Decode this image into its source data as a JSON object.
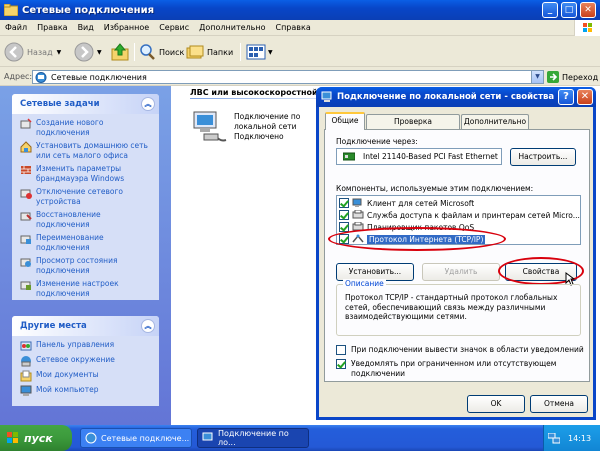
{
  "window": {
    "title": "Сетевые подключения"
  },
  "menu": [
    "Файл",
    "Правка",
    "Вид",
    "Избранное",
    "Сервис",
    "Дополнительно",
    "Справка"
  ],
  "toolbar": {
    "back": "Назад",
    "search": "Поиск",
    "folders": "Папки"
  },
  "address": {
    "label": "Адрес:",
    "value": "Сетевые подключения",
    "go": "Переход"
  },
  "left_panel": {
    "network_tasks": {
      "title": "Сетевые задачи",
      "items": [
        "Создание нового подключения",
        "Установить домашнюю сеть или сеть малого офиса",
        "Изменить параметры брандмауэра Windows",
        "Отключение сетевого устройства",
        "Восстановление подключения",
        "Переименование подключения",
        "Просмотр состояния подключения",
        "Изменение настроек подключения"
      ]
    },
    "other_places": {
      "title": "Другие места",
      "items": [
        "Панель управления",
        "Сетевое окружение",
        "Мои документы",
        "Мой компьютер"
      ]
    }
  },
  "content": {
    "section_header": "ЛВС или высокоскоростной И",
    "item": {
      "name": "Подключение по локальной сети",
      "status": "Подключено"
    }
  },
  "dialog": {
    "title": "Подключение по локальной сети - свойства",
    "tabs": [
      "Общие",
      "Проверка подлинности",
      "Дополнительно"
    ],
    "connect_via_label": "Подключение через:",
    "adapter": "Intel 21140-Based PCI Fast Ethernet",
    "configure_button": "Настроить...",
    "components_label": "Компоненты, используемые этим подключением:",
    "components": [
      {
        "label": "Клиент для сетей Microsoft",
        "checked": true
      },
      {
        "label": "Служба доступа к файлам и принтерам сетей Micro...",
        "checked": true
      },
      {
        "label": "Планировщик пакетов QoS",
        "checked": true
      },
      {
        "label": "Протокол Интернета (TCP/IP)",
        "checked": true
      }
    ],
    "install_button": "Установить...",
    "remove_button": "Удалить",
    "properties_button": "Свойства",
    "description_legend": "Описание",
    "description": "Протокол TCP/IP - стандартный протокол глобальных сетей, обеспечивающий связь между различными взаимодействующими сетями.",
    "notify_icon_label": "При подключении вывести значок в области уведомлений",
    "notify_icon_checked": false,
    "notify_limited_label": "Уведомлять при ограниченном или отсутствующем подключении",
    "notify_limited_checked": true,
    "ok_button": "OK",
    "cancel_button": "Отмена"
  },
  "taskbar": {
    "start": "пуск",
    "tasks": [
      "Сетевые подключе...",
      "Подключение по ло..."
    ],
    "clock": "14:13"
  },
  "colors": {
    "xp_blue": "#0a46c8",
    "highlight_red": "#d8000c",
    "link_blue": "#215dc6"
  }
}
